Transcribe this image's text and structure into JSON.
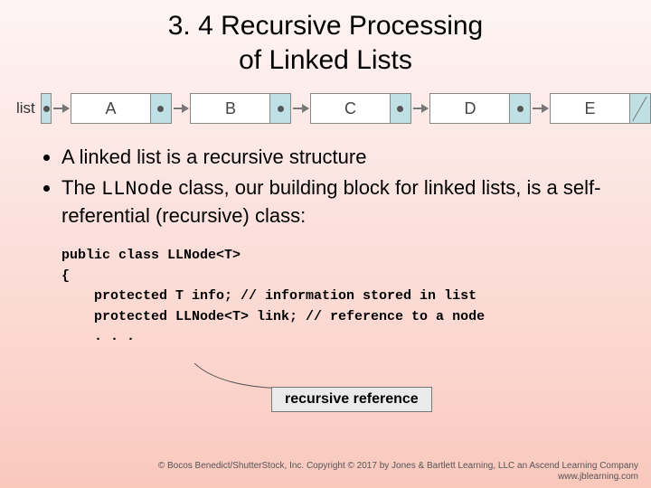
{
  "title_line1": "3. 4 Recursive Processing",
  "title_line2": "of Linked Lists",
  "diagram": {
    "label": "list",
    "nodes": [
      "A",
      "B",
      "C",
      "D",
      "E"
    ]
  },
  "bullets": {
    "b1": "A linked list is a recursive structure",
    "b2a": "The ",
    "b2code": "LLNode",
    "b2b": " class, our building block for linked lists, is a self-referential (recursive) class:"
  },
  "code": {
    "l1": "public class LLNode<T>",
    "l2": "{",
    "l3": "protected T info; // information stored in list",
    "l4": "protected LLNode<T> link; // reference to a node",
    "l5": ". . ."
  },
  "callout": "recursive reference",
  "footer": {
    "l1": "© Bocos Benedict/ShutterStock, Inc. Copyright © 2017 by Jones & Bartlett Learning, LLC an Ascend Learning Company",
    "l2": "www.jblearning.com"
  }
}
